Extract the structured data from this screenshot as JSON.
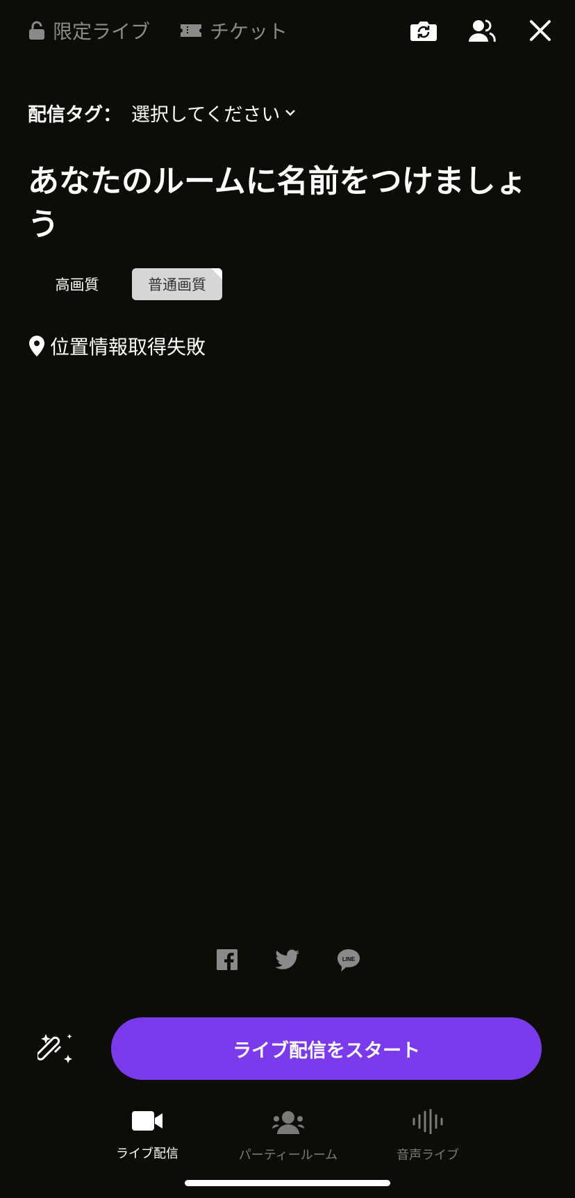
{
  "top_bar": {
    "limited_live_label": "限定ライブ",
    "ticket_label": "チケット",
    "icons": [
      "lock-icon",
      "ticket-icon",
      "camera-switch-icon",
      "users-icon",
      "close-icon"
    ]
  },
  "tag": {
    "label": "配信タグ：",
    "value": "選択してください"
  },
  "room_name_placeholder": "あなたのルームに名前をつけましょう",
  "quality": {
    "high": "高画質",
    "normal": "普通画質",
    "selected": "normal"
  },
  "location": {
    "text": "位置情報取得失敗"
  },
  "share": {
    "icons": [
      "facebook-icon",
      "twitter-icon",
      "line-icon"
    ],
    "line_text": "LINE"
  },
  "start_button": "ライブ配信をスタート",
  "tabs": [
    {
      "label": "ライブ配信",
      "icon": "video-camera-icon",
      "active": true
    },
    {
      "label": "パーティールーム",
      "icon": "group-icon",
      "active": false
    },
    {
      "label": "音声ライブ",
      "icon": "sound-wave-icon",
      "active": false
    }
  ],
  "colors": {
    "background": "#0d0c07",
    "accent": "#7c3aed",
    "muted_text": "#8a8a8a",
    "selected_quality_bg": "#d6d6d6"
  }
}
